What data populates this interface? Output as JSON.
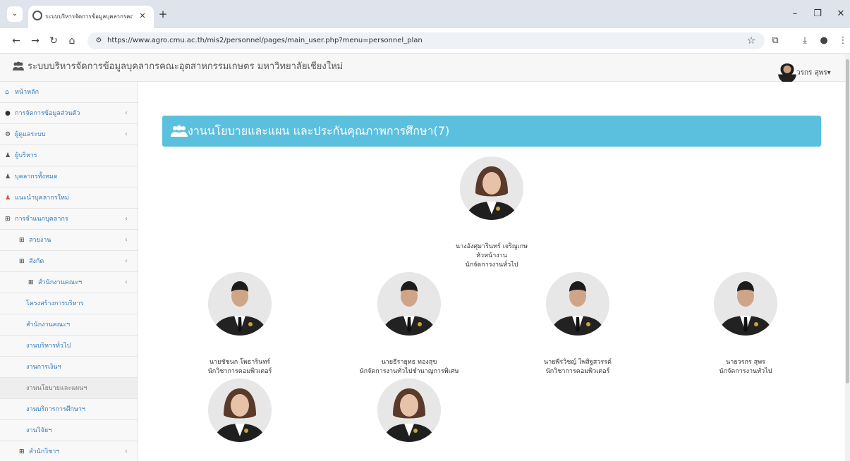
{
  "browser": {
    "tab_title": "ระบบบริหารจัดการข้อมูลบุคลากรคณะ",
    "url": "https://www.agro.cmu.ac.th/mis2/personnel/pages/main_user.php?menu=personnel_plan",
    "icons": [
      "tab-menu-icon",
      "globe-icon",
      "close-icon",
      "plus-icon",
      "back-icon",
      "forward-icon",
      "reload-icon",
      "home-icon",
      "site-info-icon",
      "star-icon",
      "extensions-icon",
      "download-icon",
      "profile-icon",
      "kebab-menu-icon",
      "minimize-icon",
      "restore-icon",
      "close-window-icon"
    ]
  },
  "header": {
    "brand": "ระบบบริหารจัดการข้อมูลบุคลากรคณะอุตสาหกรรมเกษตร มหาวิทยาลัยเชียงใหม่",
    "username": "วรกร สุพร"
  },
  "sidebar": {
    "items": [
      {
        "label": "หน้าหลัก",
        "icon": "home-icon",
        "chevron": false
      },
      {
        "label": "การจัดการข้อมูลส่วนตัว",
        "icon": "user-icon",
        "chevron": true
      },
      {
        "label": "ผู้ดูแลระบบ",
        "icon": "cogs-icon",
        "chevron": true
      },
      {
        "label": "ผู้บริหาร",
        "icon": "users-icon",
        "chevron": false
      },
      {
        "label": "บุคลากรทั้งหมด",
        "icon": "users-icon",
        "chevron": false
      },
      {
        "label": "แนะนำบุคลากรใหม่",
        "icon": "users-icon",
        "chevron": false
      },
      {
        "label": "การจำแนกบุคลากร",
        "icon": "sitemap-icon",
        "chevron": true
      },
      {
        "label": "สายงาน",
        "icon": "sitemap-icon",
        "chevron": true
      },
      {
        "label": "สังกัด",
        "icon": "sitemap-icon",
        "chevron": true
      },
      {
        "label": "สำนักงานคณะฯ",
        "icon": "sitemap-icon",
        "chevron": true
      },
      {
        "label": "โครงสร้างการบริหาร",
        "icon": "",
        "chevron": false
      },
      {
        "label": "สำนักงานคณะฯ",
        "icon": "",
        "chevron": false
      },
      {
        "label": "งานบริหารทั่วไป",
        "icon": "",
        "chevron": false
      },
      {
        "label": "งานการเงินฯ",
        "icon": "",
        "chevron": false
      },
      {
        "label": "งานนโยบายและแผนฯ",
        "icon": "",
        "chevron": false,
        "active": true
      },
      {
        "label": "งานบริการการศึกษาฯ",
        "icon": "",
        "chevron": false
      },
      {
        "label": "งานวิจัยฯ",
        "icon": "",
        "chevron": false
      },
      {
        "label": "สำนักวิชาฯ",
        "icon": "sitemap-icon",
        "chevron": true
      }
    ]
  },
  "main": {
    "heading": "งานนโยบายและแผน และประกันคุณภาพการศึกษา(7)",
    "people": [
      {
        "name": "นางอังศุมารินทร์ เจริญเกษ",
        "position": "หัวหน้างาน",
        "role": "นักจัดการงานทั่วไป",
        "gender": "f"
      },
      {
        "name": "นายชัชนก โพธารินทร์",
        "position": "",
        "role": "นักวิชาการคอมพิวเตอร์",
        "gender": "m"
      },
      {
        "name": "นายธีรายุทธ ทองสุข",
        "position": "",
        "role": "นักจัดการงานทั่วไปชำนาญการพิเศษ",
        "gender": "m"
      },
      {
        "name": "นายพีรวิชญ์ ไพสิฐสวรรค์",
        "position": "",
        "role": "นักวิชาการคอมพิวเตอร์",
        "gender": "m"
      },
      {
        "name": "นายวรกร สุพร",
        "position": "",
        "role": "นักจัดการงานทั่วไป",
        "gender": "m"
      },
      {
        "name": "",
        "position": "",
        "role": "",
        "gender": "f"
      },
      {
        "name": "",
        "position": "",
        "role": "",
        "gender": "f"
      }
    ]
  },
  "colors": {
    "heading_bg": "#5bc0de",
    "link": "#337ab7",
    "tabbar": "#dfe3eb"
  }
}
